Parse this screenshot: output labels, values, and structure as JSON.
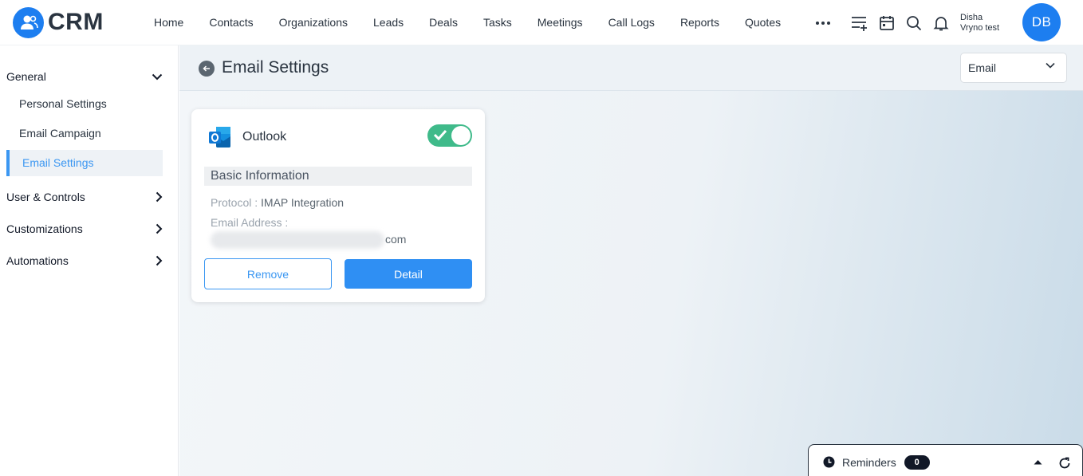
{
  "app": {
    "logo_text": "CRM"
  },
  "nav": {
    "items": [
      "Home",
      "Contacts",
      "Organizations",
      "Leads",
      "Deals",
      "Tasks",
      "Meetings",
      "Call Logs",
      "Reports",
      "Quotes"
    ],
    "more_icon": "ellipsis-icon",
    "icons": [
      "add-list-icon",
      "calendar-icon",
      "search-icon",
      "bell-icon"
    ]
  },
  "user": {
    "first_name": "Disha",
    "last_name": "Vryno test",
    "initials": "DB"
  },
  "sidebar": {
    "groups": [
      {
        "label": "General",
        "expanded": true,
        "items": [
          "Personal Settings",
          "Email Campaign",
          "Email Settings"
        ],
        "active_item": "Email Settings"
      },
      {
        "label": "User & Controls",
        "expanded": false
      },
      {
        "label": "Customizations",
        "expanded": false
      },
      {
        "label": "Automations",
        "expanded": false
      }
    ]
  },
  "page": {
    "title": "Email Settings",
    "select_value": "Email"
  },
  "card": {
    "provider": "Outlook",
    "enabled": true,
    "section_title": "Basic Information",
    "protocol_label": "Protocol :",
    "protocol_value": "IMAP Integration",
    "email_label": "Email Address :",
    "email_visible_suffix": "com",
    "remove_label": "Remove",
    "detail_label": "Detail"
  },
  "reminders": {
    "label": "Reminders",
    "count": "0"
  },
  "colors": {
    "accent": "#1d7ef0",
    "toggle_on": "#3fba8a",
    "active_link": "#3b97f2"
  }
}
